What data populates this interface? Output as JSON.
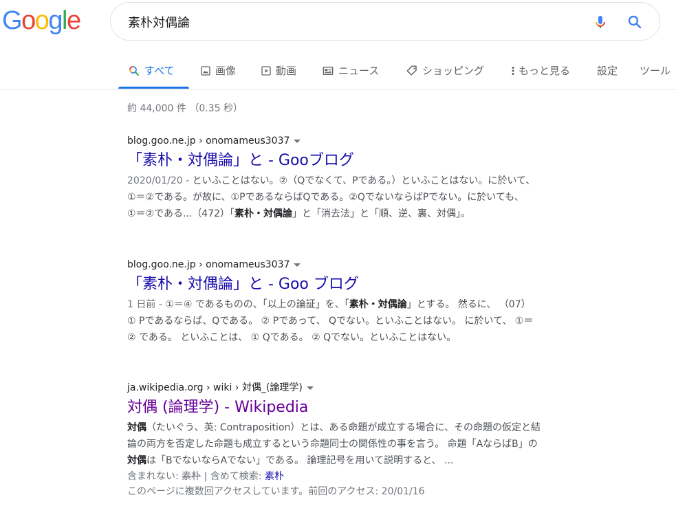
{
  "logo": {
    "letters": [
      "G",
      "o",
      "o",
      "g",
      "l",
      "e"
    ],
    "colors": [
      "#4285F4",
      "#EA4335",
      "#FBBC05",
      "#4285F4",
      "#34A853",
      "#EA4335"
    ]
  },
  "search": {
    "query": "素朴対偶論"
  },
  "tabs": [
    {
      "label": "すべて",
      "icon": "search-icon",
      "active": true
    },
    {
      "label": "画像",
      "icon": "image-icon"
    },
    {
      "label": "動画",
      "icon": "video-icon"
    },
    {
      "label": "ニュース",
      "icon": "news-icon"
    },
    {
      "label": "ショッピング",
      "icon": "tag-icon"
    },
    {
      "label": "もっと見る",
      "icon": "more-vert-icon"
    },
    {
      "label": "設定"
    },
    {
      "label": "ツール"
    }
  ],
  "stats": "約 44,000 件 （0.35 秒）",
  "results": [
    {
      "cite": "blog.goo.ne.jp › onomameus3037",
      "title": "「素朴・対偶論」と - Gooブログ",
      "date": "2020/01/20 - ",
      "lines": [
        [
          "といふことはない。②（Qでなくて、Pである。）といふことはない。に於いて、"
        ],
        [
          "①＝②である。が故に、①PであるならばQである。②QでないならばPでない。に於いても、"
        ],
        [
          "①＝②である...（472）「",
          "素朴・対偶論",
          "」と「消去法」と「順、逆、裏、対偶」。"
        ]
      ]
    },
    {
      "cite": "blog.goo.ne.jp › onomameus3037",
      "title": "「素朴・対偶論」と - Goo ブログ",
      "date": "1 日前 - ",
      "lines": [
        [
          "①＝④ であるものの、「以上の論証」を、「",
          "素朴・対偶論",
          "」とする。 然るに、 （07）"
        ],
        [
          "① Pであるならば、Qである。 ② Pであって、 Qでない。といふことはない。 に於いて、 ①＝"
        ],
        [
          "② である。 といふことは、 ① Qである。 ② Qでない。といふことはない。"
        ]
      ]
    },
    {
      "cite": "ja.wikipedia.org › wiki › 対偶_(論理学)",
      "title": "対偶 (論理学) - Wikipedia",
      "lines": [
        [
          "",
          "対偶",
          "（たいぐう、英: Contraposition）とは、ある命題が成立する場合に、その命題の仮定と結"
        ],
        [
          "論の両方を否定した命題も成立するという命題同士の関係性の事を言う。 命題「AならばB」の"
        ],
        [
          "",
          "対偶",
          "は「BでないならAでない」である。 論理記号を用いて説明すると、 ..."
        ]
      ],
      "missing_prefix": "含まれない: ",
      "missing_word": "素朴",
      "missing_sep": " | 含めて検索: ",
      "missing_link": "素朴",
      "visited": "このページに複数回アクセスしています。前回のアクセス: 20/01/16"
    }
  ]
}
